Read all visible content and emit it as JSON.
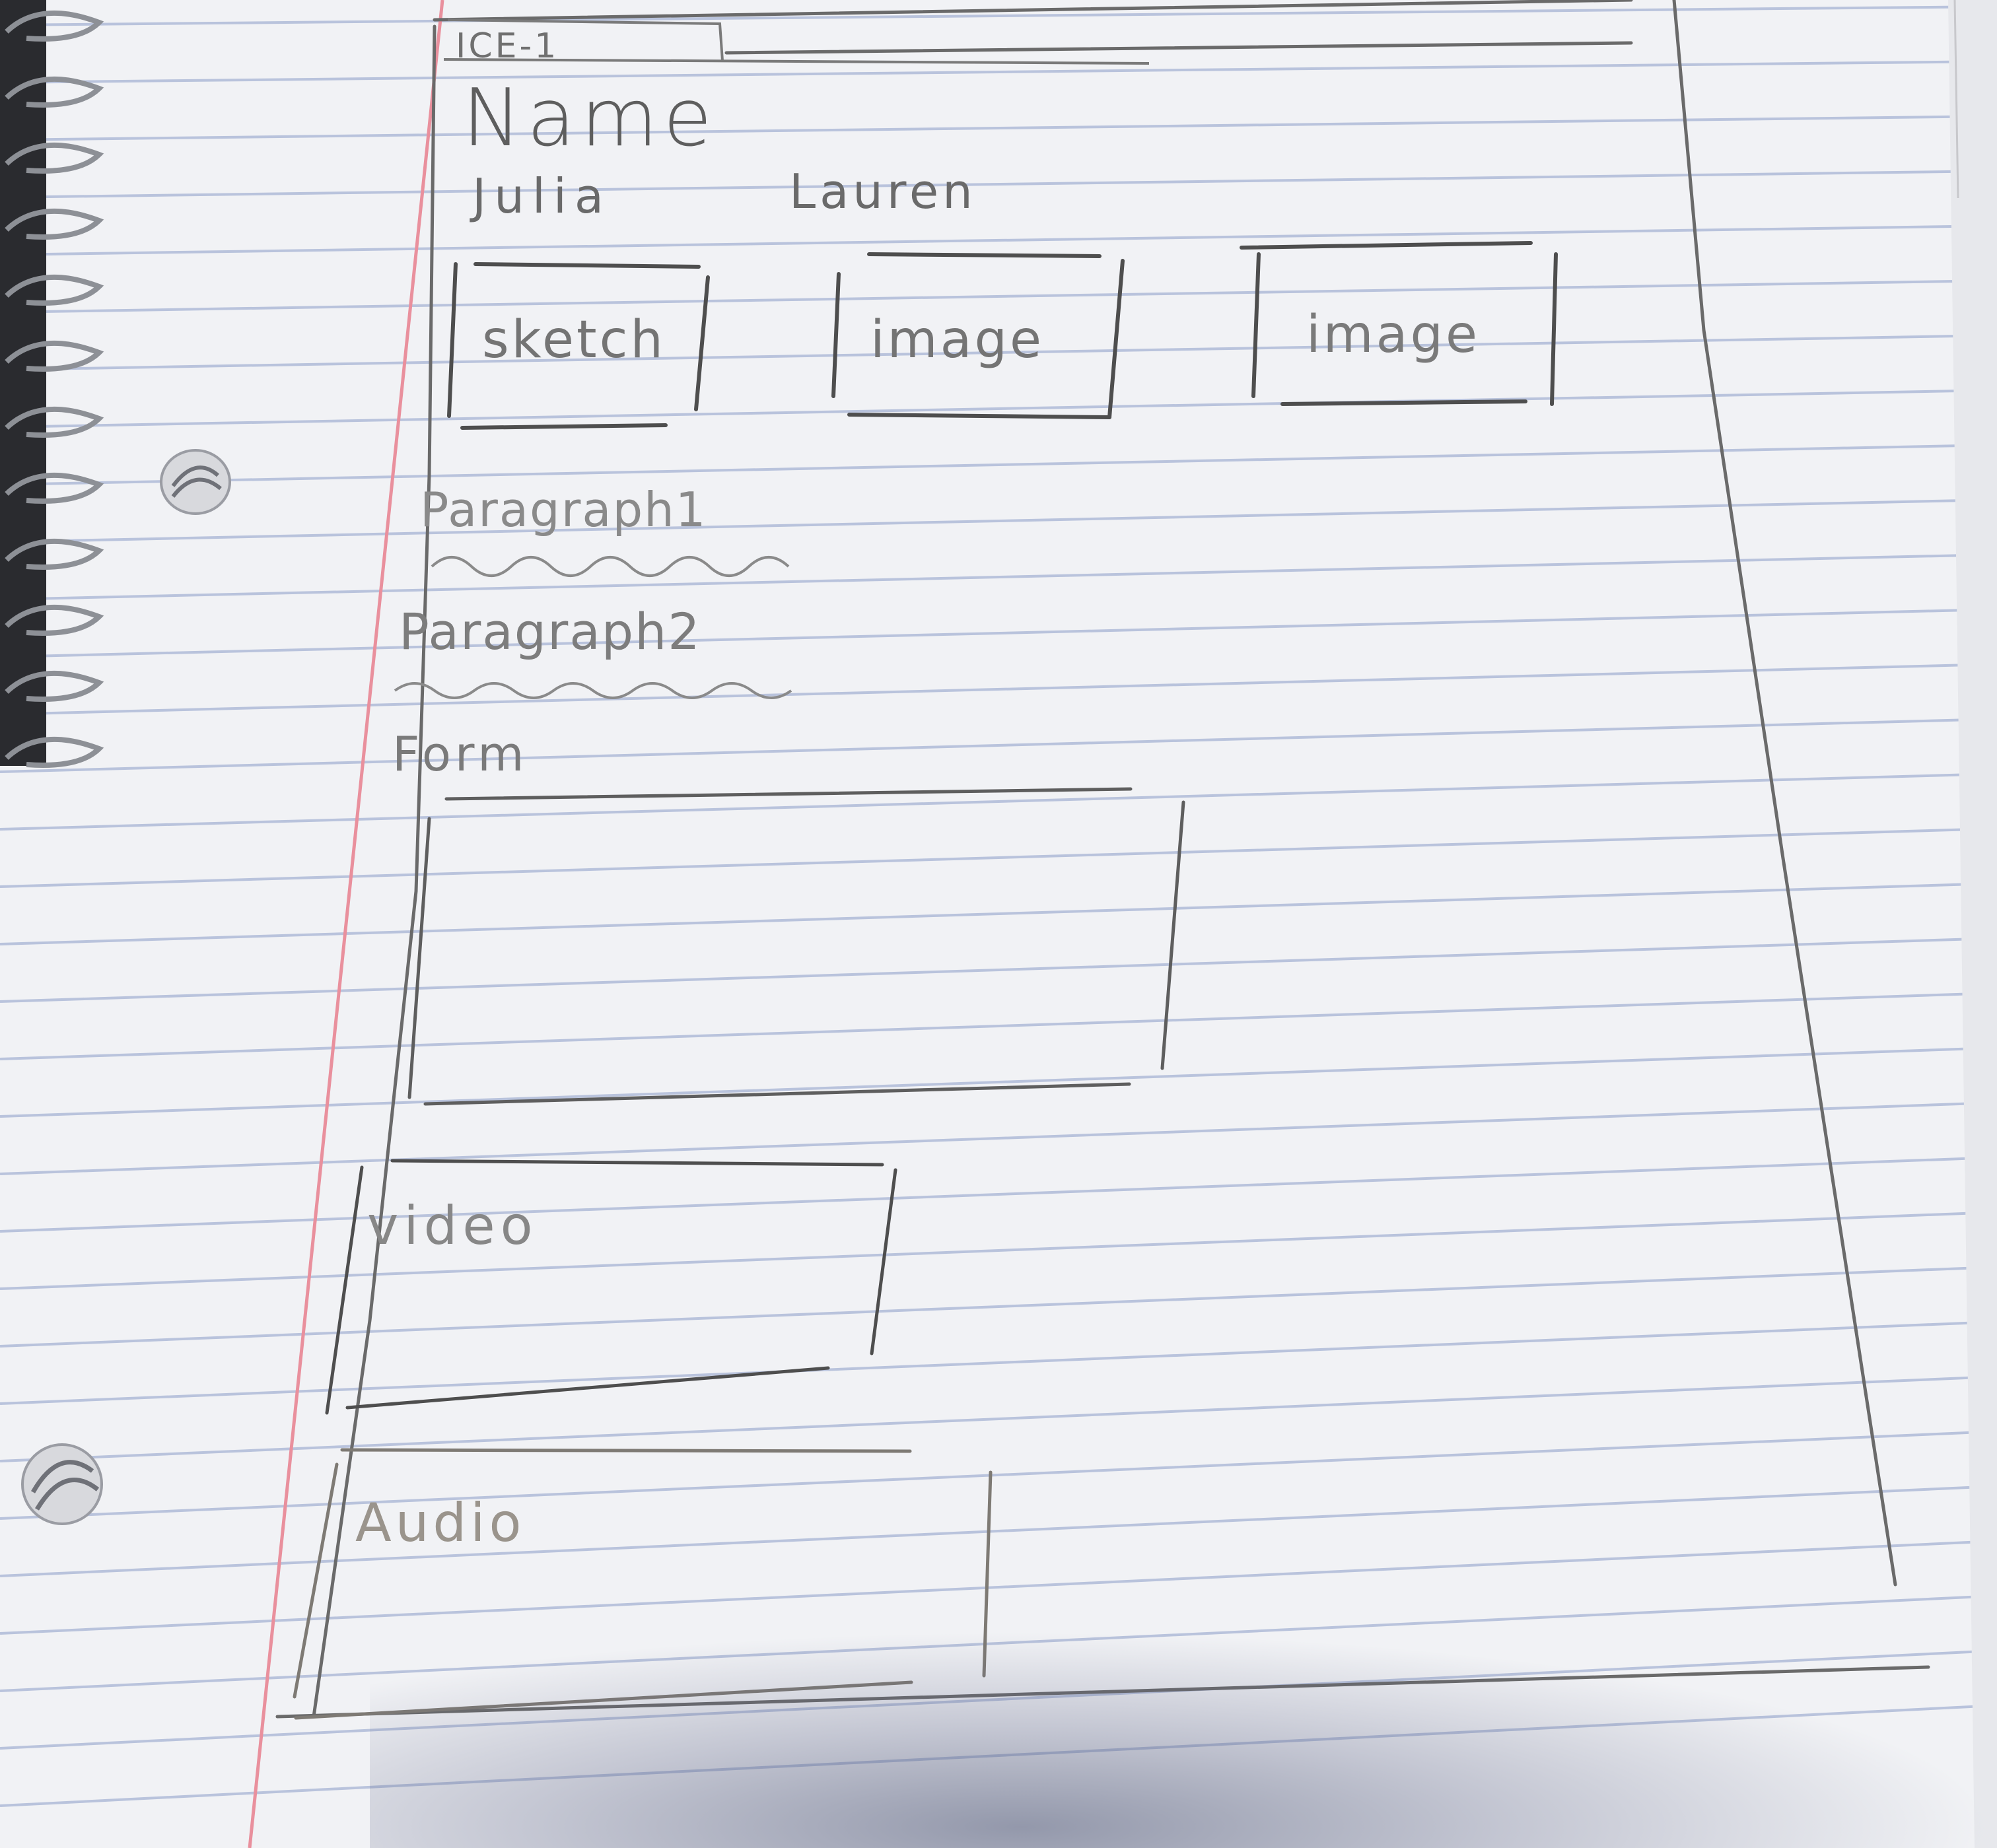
{
  "sketch": {
    "header": "ICE-1",
    "title": "Name",
    "names": [
      "Julia",
      "Lauren"
    ],
    "top_boxes": [
      "sketch",
      "image",
      "image"
    ],
    "paragraphs": [
      "Paragraph1",
      "Paragraph2"
    ],
    "form_label": "Form",
    "video_label": "video",
    "audio_label": "Audio"
  },
  "colors": {
    "paper": "#f1f2f5",
    "ruled_line": "#b8c2dc",
    "margin_line": "#e88a98",
    "pencil": "#6b6b6b"
  }
}
